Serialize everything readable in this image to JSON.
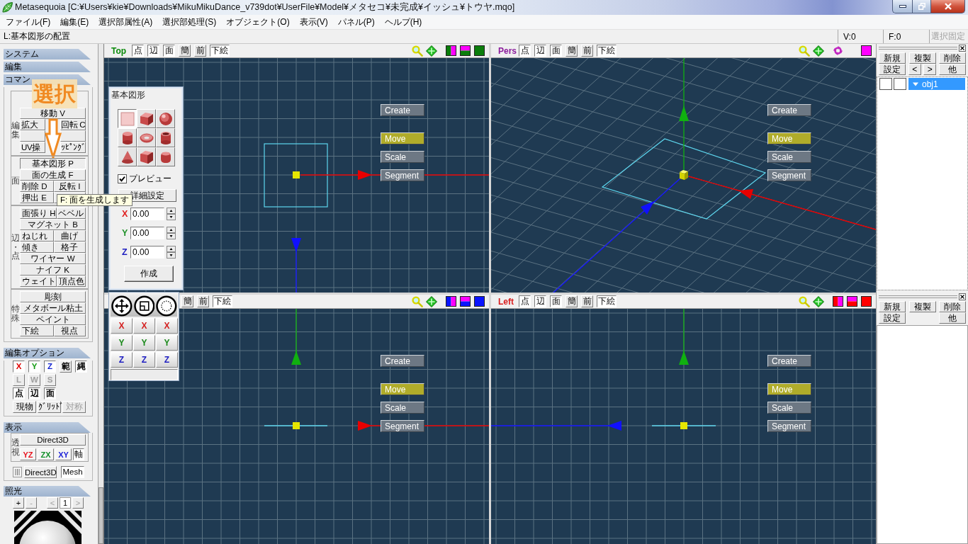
{
  "window": {
    "title": "Metasequoia [C:¥Users¥kie¥Downloads¥MikuMikuDance_v739dot¥UserFile¥Model¥メタセコ¥未完成¥イッシュ¥トウヤ.mqo]"
  },
  "menu": [
    "ファイル(F)",
    "編集(E)",
    "選択部属性(A)",
    "選択部処理(S)",
    "オブジェクト(O)",
    "表示(V)",
    "パネル(P)",
    "ヘルプ(H)"
  ],
  "status_bar": {
    "message": "L:基本図形の配置",
    "vertices": "V:0",
    "faces": "F:0",
    "lock": {
      "label": "選択固定",
      "disabled": true
    }
  },
  "sidebar": {
    "system": {
      "title": "システム"
    },
    "edit": {
      "title": "編集"
    },
    "commands": {
      "title": "コマン",
      "groups": [
        {
          "label": "編集",
          "annotation": {
            "label": "選択"
          },
          "rows": [
            [
              {
                "label": "移動 V",
                "selected": false
              }
            ],
            [
              {
                "label": "拡大",
                "selected": false
              },
              {
                "label": "回転 C",
                "selected": false
              }
            ],
            [
              {
                "selected": false
              },
              {
                "selected": false
              }
            ],
            [
              {
                "label": "UV操",
                "selected": false
              },
              {
                "label": "ｯﾋﾟﾝｸﾞ",
                "selected": false
              }
            ]
          ]
        },
        {
          "label": "面",
          "rows": [
            [
              {
                "label": "基本図形 P",
                "selected": true
              }
            ],
            [
              {
                "label": "面の生成 F",
                "selected": false
              }
            ],
            [
              {
                "label": "削除 D",
                "selected": false
              },
              {
                "label": "反転 I",
                "selected": false
              }
            ],
            [
              {
                "label": "押出 E",
                "selected": false
              },
              {
                "selected": false
              }
            ]
          ]
        },
        {
          "label": "辺・点",
          "rows": [
            [
              {
                "label": "面張り H",
                "selected": false
              },
              {
                "label": "ベベル",
                "selected": false
              }
            ],
            [
              {
                "label": "マグネット B",
                "selected": false
              }
            ],
            [
              {
                "label": "ねじれ",
                "selected": false
              },
              {
                "label": "曲げ",
                "selected": false
              }
            ],
            [
              {
                "label": "傾き",
                "selected": false
              },
              {
                "label": "格子",
                "selected": false
              }
            ],
            [
              {
                "label": "ワイヤー W",
                "selected": false
              }
            ],
            [
              {
                "label": "ナイフ K",
                "selected": false
              }
            ],
            [
              {
                "label": "ウェイト",
                "selected": false
              },
              {
                "label": "頂点色",
                "selected": false
              }
            ]
          ]
        },
        {
          "label": "特殊",
          "rows": [
            [
              {
                "label": "彫刻",
                "selected": false
              }
            ],
            [
              {
                "label": "メタボール粘土",
                "selected": false
              }
            ],
            [
              {
                "label": "ペイント",
                "selected": false
              }
            ],
            [
              {
                "label": "下絵",
                "selected": false
              },
              {
                "label": "視点",
                "selected": false
              }
            ]
          ]
        }
      ]
    },
    "edit_options": {
      "title": "編集オプション",
      "axis_toggles": [
        {
          "label": "X",
          "on": true,
          "disabled": false,
          "color": "#e00000"
        },
        {
          "label": "Y",
          "on": true,
          "disabled": false,
          "color": "#139a13"
        },
        {
          "label": "Z",
          "on": true,
          "disabled": false,
          "color": "#1020d0"
        }
      ],
      "selection_toggles": [
        {
          "label": "範",
          "on": false,
          "disabled": false
        },
        {
          "label": "縄",
          "on": true,
          "disabled": false
        }
      ],
      "coordinate_toggles": [
        {
          "label": "L",
          "on": false,
          "disabled": true
        },
        {
          "label": "W",
          "on": false,
          "disabled": true
        },
        {
          "label": "S",
          "on": false,
          "disabled": true
        }
      ],
      "element_toggles": [
        {
          "label": "点",
          "on": true,
          "disabled": false
        },
        {
          "label": "辺",
          "on": true,
          "disabled": false
        },
        {
          "label": "面",
          "on": true,
          "disabled": false
        }
      ],
      "option_toggles": [
        {
          "label": "現物",
          "on": false,
          "disabled": false
        },
        {
          "label": "ｸﾞﾘｯﾄﾞ",
          "on": false,
          "disabled": false
        },
        {
          "label": "対称",
          "on": false,
          "disabled": true
        }
      ]
    },
    "display": {
      "title": "表示",
      "group_label": "透視",
      "perspective_button": "Direct3D",
      "planes": [
        {
          "label": "YZ",
          "color": "#e8141e"
        },
        {
          "label": "ZX",
          "color": "#12902a"
        },
        {
          "label": "XY",
          "color": "#1c22d8"
        }
      ],
      "axis": {
        "label": "軸",
        "on": true
      },
      "render_button": "Direct3D",
      "mesh": {
        "label": "Mesh",
        "on": true
      }
    },
    "lighting": {
      "title": "照光",
      "controls": [
        {
          "kind": "button",
          "label": "+",
          "disabled": false
        },
        {
          "kind": "button",
          "label": "-",
          "disabled": true
        },
        {
          "kind": "button",
          "label": "<",
          "disabled": true
        },
        {
          "kind": "field",
          "value": "1",
          "disabled": false
        },
        {
          "kind": "button",
          "label": ">",
          "disabled": true
        }
      ]
    }
  },
  "viewports": [
    {
      "kind": "top",
      "label": "Top",
      "buttons": [
        {
          "label": "点",
          "on": true
        },
        {
          "label": "辺",
          "on": true
        },
        {
          "label": "面",
          "on": true
        },
        {
          "label": "簡",
          "on": false
        },
        {
          "label": "前",
          "on": false
        },
        {
          "label": "下絵",
          "on": true
        }
      ],
      "modes": [
        {
          "label": "Create",
          "selected": false
        },
        {
          "label": "Move",
          "selected": true
        },
        {
          "label": "Scale",
          "selected": false
        },
        {
          "label": "Segment",
          "selected": false
        }
      ]
    },
    {
      "kind": "perspective",
      "label": "Pers",
      "buttons": [
        {
          "label": "点",
          "on": true
        },
        {
          "label": "辺",
          "on": true
        },
        {
          "label": "面",
          "on": true
        },
        {
          "label": "簡",
          "on": false
        },
        {
          "label": "前",
          "on": false
        },
        {
          "label": "下絵",
          "on": true
        }
      ],
      "modes": [
        {
          "label": "Create",
          "selected": false
        },
        {
          "label": "Move",
          "selected": true
        },
        {
          "label": "Scale",
          "selected": false
        },
        {
          "label": "Segment",
          "selected": false
        }
      ]
    },
    {
      "kind": "front",
      "buttons": [
        {
          "label": "簡",
          "on": false
        },
        {
          "label": "前",
          "on": false
        },
        {
          "label": "下絵",
          "on": true
        }
      ],
      "modes": [
        {
          "label": "Create",
          "selected": false
        },
        {
          "label": "Move",
          "selected": true
        },
        {
          "label": "Scale",
          "selected": false
        },
        {
          "label": "Segment",
          "selected": false
        }
      ]
    },
    {
      "kind": "left",
      "label": "Left",
      "buttons": [
        {
          "label": "点",
          "on": true
        },
        {
          "label": "辺",
          "on": true
        },
        {
          "label": "面",
          "on": true
        },
        {
          "label": "簡",
          "on": false
        },
        {
          "label": "前",
          "on": false
        },
        {
          "label": "下絵",
          "on": true
        }
      ],
      "modes": [
        {
          "label": "Create",
          "selected": false
        },
        {
          "label": "Move",
          "selected": true
        },
        {
          "label": "Scale",
          "selected": false
        },
        {
          "label": "Segment",
          "selected": false
        }
      ]
    }
  ],
  "primitive_panel": {
    "title": "基本図形",
    "shapes": [
      {
        "kind": "plane",
        "selected": true
      },
      {
        "kind": "cube",
        "selected": false
      },
      {
        "kind": "sphere",
        "selected": false
      },
      {
        "kind": "cylinder",
        "selected": false
      },
      {
        "kind": "torus",
        "selected": false
      },
      {
        "kind": "pipe",
        "selected": false
      },
      {
        "kind": "cone",
        "selected": false
      },
      {
        "kind": "rounded-cube",
        "selected": false
      },
      {
        "kind": "rounded-cylinder",
        "selected": false
      }
    ],
    "preview": {
      "label": "プレビュー",
      "checked": true
    },
    "detail_button": "詳細設定",
    "fields": [
      {
        "label": "X",
        "value": "0.00",
        "color": "#e02020"
      },
      {
        "label": "Y",
        "value": "0.00",
        "color": "#22922a"
      },
      {
        "label": "Z",
        "value": "0.00",
        "color": "#2020c0"
      }
    ],
    "create_button": "作成"
  },
  "axis_panel": {
    "tools": [
      {
        "kind": "move"
      },
      {
        "kind": "scale"
      },
      {
        "kind": "rotate"
      }
    ],
    "rows": [
      [
        {
          "label": "X",
          "color": "#d42020"
        },
        {
          "label": "X",
          "color": "#d42020"
        },
        {
          "label": "X",
          "color": "#d42020"
        }
      ],
      [
        {
          "label": "Y",
          "color": "#1d8a1d"
        },
        {
          "label": "Y",
          "color": "#1d8a1d"
        },
        {
          "label": "Y",
          "color": "#1d8a1d"
        }
      ],
      [
        {
          "label": "Z",
          "color": "#1c1cc0"
        },
        {
          "label": "Z",
          "color": "#1c1cc0"
        },
        {
          "label": "Z",
          "color": "#1c1cc0"
        }
      ]
    ]
  },
  "object_panel": {
    "toolbar": [
      [
        "新規",
        "複製",
        "削除"
      ],
      [
        "設定",
        "<",
        ">",
        "他"
      ]
    ],
    "objects": [
      {
        "name": "obj1",
        "selected": true,
        "expanded": true
      }
    ]
  },
  "material_panel": {
    "toolbar": [
      [
        "新規",
        "複製",
        "削除"
      ],
      [
        "設定",
        "他"
      ]
    ]
  },
  "tooltip": {
    "text": "F: 面を生成します"
  }
}
